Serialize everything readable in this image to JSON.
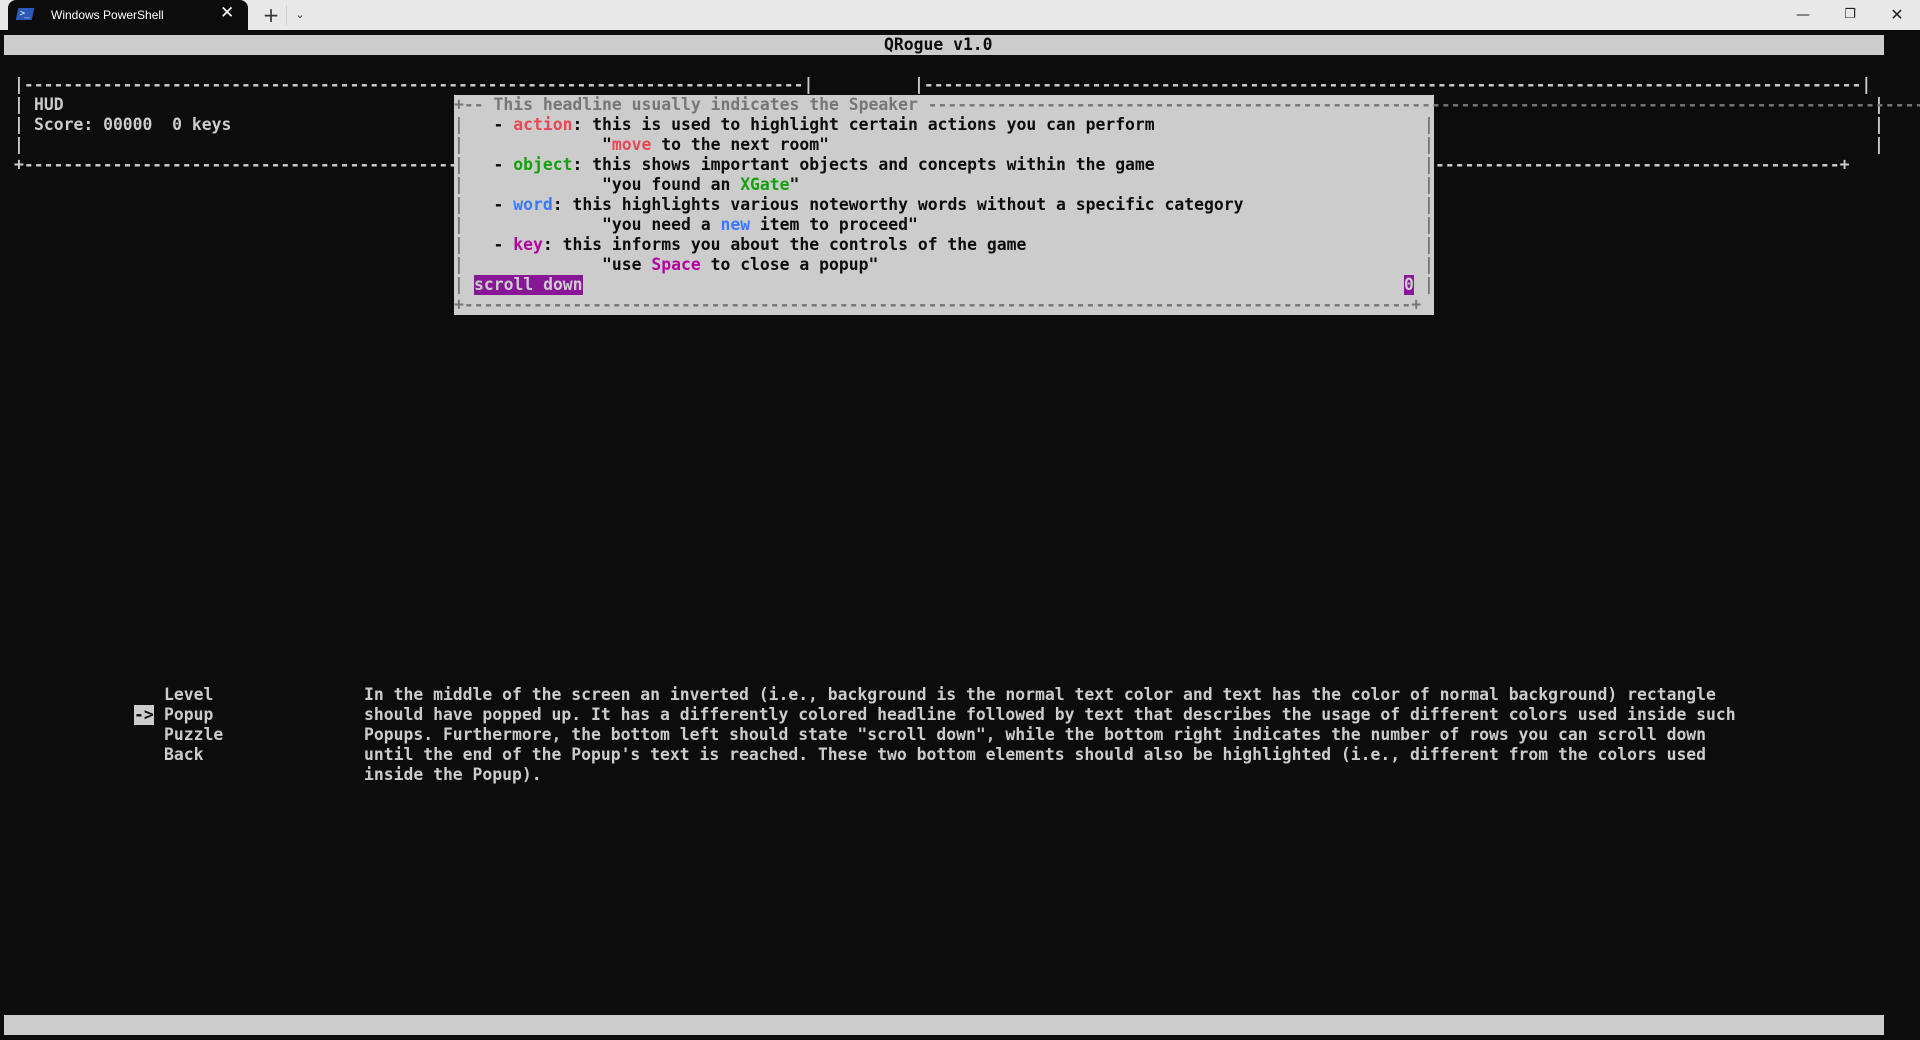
{
  "window": {
    "tab_title": "Windows PowerShell",
    "tab_icon": "powershell-icon",
    "tab_close_glyph": "✕",
    "new_tab_glyph": "+",
    "dropdown_glyph": "⌄",
    "minimize_glyph": "—",
    "maximize_glyph": "❐",
    "close_glyph": "✕"
  },
  "app": {
    "title": "QRogue v1.0"
  },
  "hud": {
    "border_top_left": "|-------------------------------------------------------------------------------|",
    "border_top_right": "|-----------------------------------------------------------------------------------------------|",
    "side": "|",
    "title": "HUD",
    "score_line": "Score: 00000  0 keys",
    "border_bottom": "+----------------------------------------------------------------------------------------------------------------------------------------------------------------------------------------+"
  },
  "popup": {
    "headline": "This headline usually indicates the Speaker",
    "headline_prefix": "+-- ",
    "headline_suffix": " ------------------------------------------------------------------------------------------------------------------------------------------------------+",
    "border_bottom": "+------------------------------------------------------------------------------------------------+",
    "side": "|",
    "lines": [
      {
        "bullet": "- ",
        "term": "action",
        "rest": ": this is used to highlight certain actions you can perform",
        "color": "#e74856"
      },
      {
        "pre": "\"",
        "word": "move",
        "post": " to the next room\"",
        "color": "#e74856"
      },
      {
        "bullet": "- ",
        "term": "object",
        "rest": ": this shows important objects and concepts within the game",
        "color": "#13a10e"
      },
      {
        "pre": "\"you found an ",
        "word": "XGate",
        "post": "\"",
        "color": "#13a10e"
      },
      {
        "bullet": "- ",
        "term": "word",
        "rest": ": this highlights various noteworthy words without a specific category",
        "color": "#3b78ff"
      },
      {
        "pre": "\"you need a ",
        "word": "new",
        "post": " item to proceed\"",
        "color": "#3b78ff"
      },
      {
        "bullet": "- ",
        "term": "key",
        "rest": ": this informs you about the controls of the game",
        "color": "#b4009e"
      },
      {
        "pre": "\"use ",
        "word": "Space",
        "post": " to close a popup\"",
        "color": "#b4009e"
      }
    ],
    "scroll_label": "scroll down",
    "scroll_count": "0",
    "highlight_color": "#881798"
  },
  "menu": {
    "selector": "->",
    "items": [
      {
        "label": "Level"
      },
      {
        "label": "Popup",
        "selected": true
      },
      {
        "label": "Puzzle"
      },
      {
        "label": "Back"
      }
    ]
  },
  "description": {
    "lines": [
      "In the middle of the screen an inverted (i.e., background is the normal text color and text has the color of normal background) rectangle",
      "should have popped up. It has a differently colored headline followed by text that describes the usage of different colors used inside such",
      "Popups. Furthermore, the bottom left should state \"scroll down\", while the bottom right indicates the number of rows you can scroll down",
      "until the end of the Popup's text is reached. These two bottom elements should also be highlighted (i.e., different from the colors used",
      "inside the Popup)."
    ]
  },
  "colors": {
    "background": "#0c0c0c",
    "foreground": "#cccccc",
    "popup_border": "#767676",
    "action": "#e74856",
    "object": "#13a10e",
    "word": "#3b78ff",
    "key": "#b4009e",
    "highlight": "#881798"
  }
}
